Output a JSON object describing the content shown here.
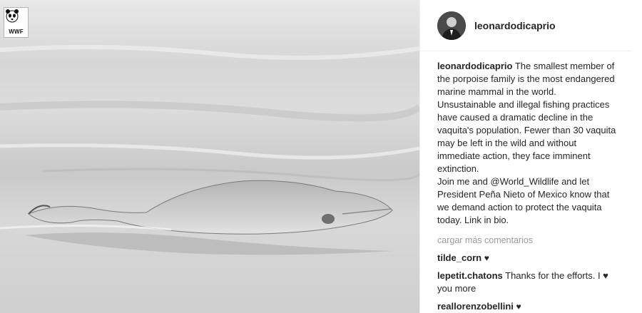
{
  "badge": {
    "text": "WWF"
  },
  "header": {
    "username": "leonardodicaprio"
  },
  "caption": {
    "username": "leonardodicaprio",
    "lines": [
      "The smallest member of",
      "the porpoise family is the most endangered",
      "marine mammal in the world.",
      "Unsustainable and illegal fishing practices",
      "have caused a dramatic decline in the",
      "vaquita's population. Fewer than 30 vaquita",
      "may be left in the wild and without",
      "immediate action, they face imminent",
      "extinction.",
      "Join me and @World_Wildlife and let",
      "President Peña Nieto of Mexico know that",
      "we demand action to protect the vaquita",
      "today. Link in bio."
    ]
  },
  "load_more": "cargar más comentarios",
  "comments": [
    {
      "username": "tilde_corn",
      "text": "♥"
    },
    {
      "username": "lepetit.chatons",
      "text": "Thanks for the efforts. I ♥",
      "continuation": "you more"
    },
    {
      "username": "reallorenzobellini",
      "text": "♥"
    }
  ]
}
